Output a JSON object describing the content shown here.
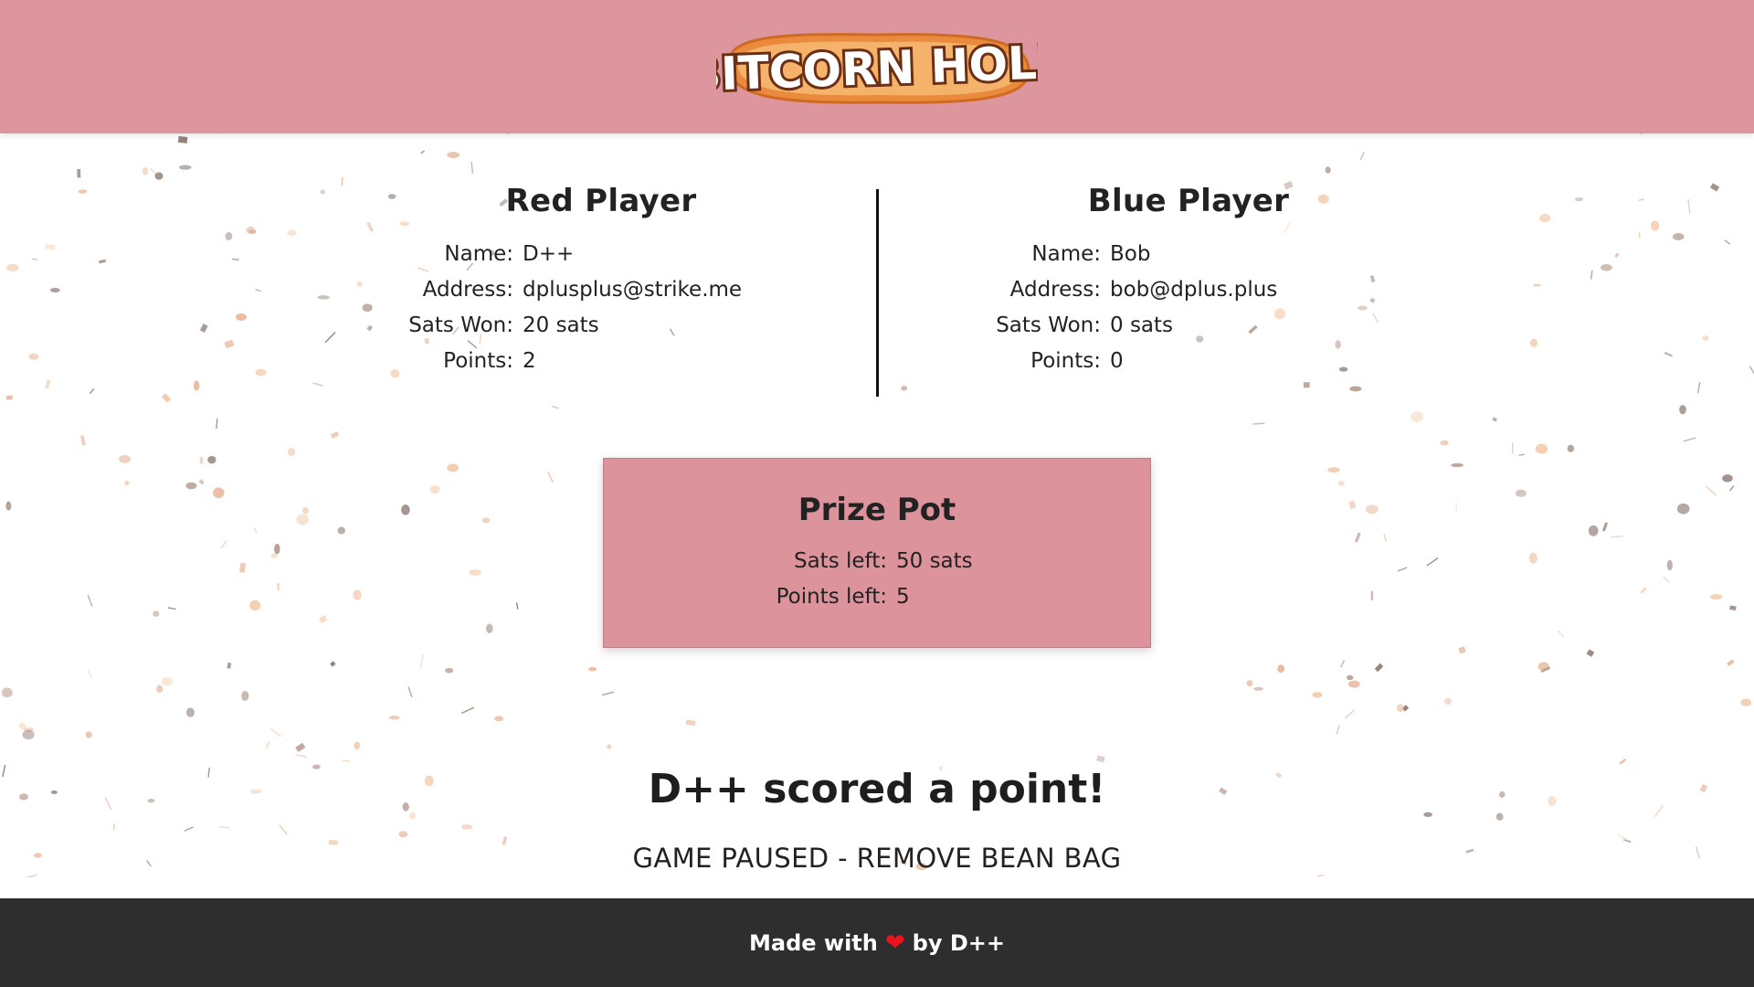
{
  "header": {
    "logo_text": "BITCORN HOLE",
    "background_color": "#dd959e"
  },
  "players": {
    "red": {
      "title": "Red Player",
      "name_label": "Name:",
      "name": "D++",
      "address_label": "Address:",
      "address": "dplusplus@strike.me",
      "sats_label": "Sats Won:",
      "sats": "20 sats",
      "points_label": "Points:",
      "points": "2"
    },
    "blue": {
      "title": "Blue Player",
      "name_label": "Name:",
      "name": "Bob",
      "address_label": "Address:",
      "address": "bob@dplus.plus",
      "sats_label": "Sats Won:",
      "sats": "0 sats",
      "points_label": "Points:",
      "points": "0"
    }
  },
  "prize_pot": {
    "title": "Prize Pot",
    "sats_left_label": "Sats left:",
    "sats_left": "50 sats",
    "points_left_label": "Points left:",
    "points_left": "5"
  },
  "message": "D++ scored a point!",
  "status": "GAME PAUSED - REMOVE BEAN BAG",
  "footer": {
    "made_with": "Made with",
    "heart_icon": "heart-icon",
    "by": "by D++"
  },
  "colors": {
    "accent_pink": "#dd939c",
    "footer_bg": "#2e2e2e",
    "heart": "#e8141e",
    "confetti": [
      "#f2c9a8",
      "#b59a8c",
      "#e8b89c",
      "#8c7a70"
    ]
  }
}
